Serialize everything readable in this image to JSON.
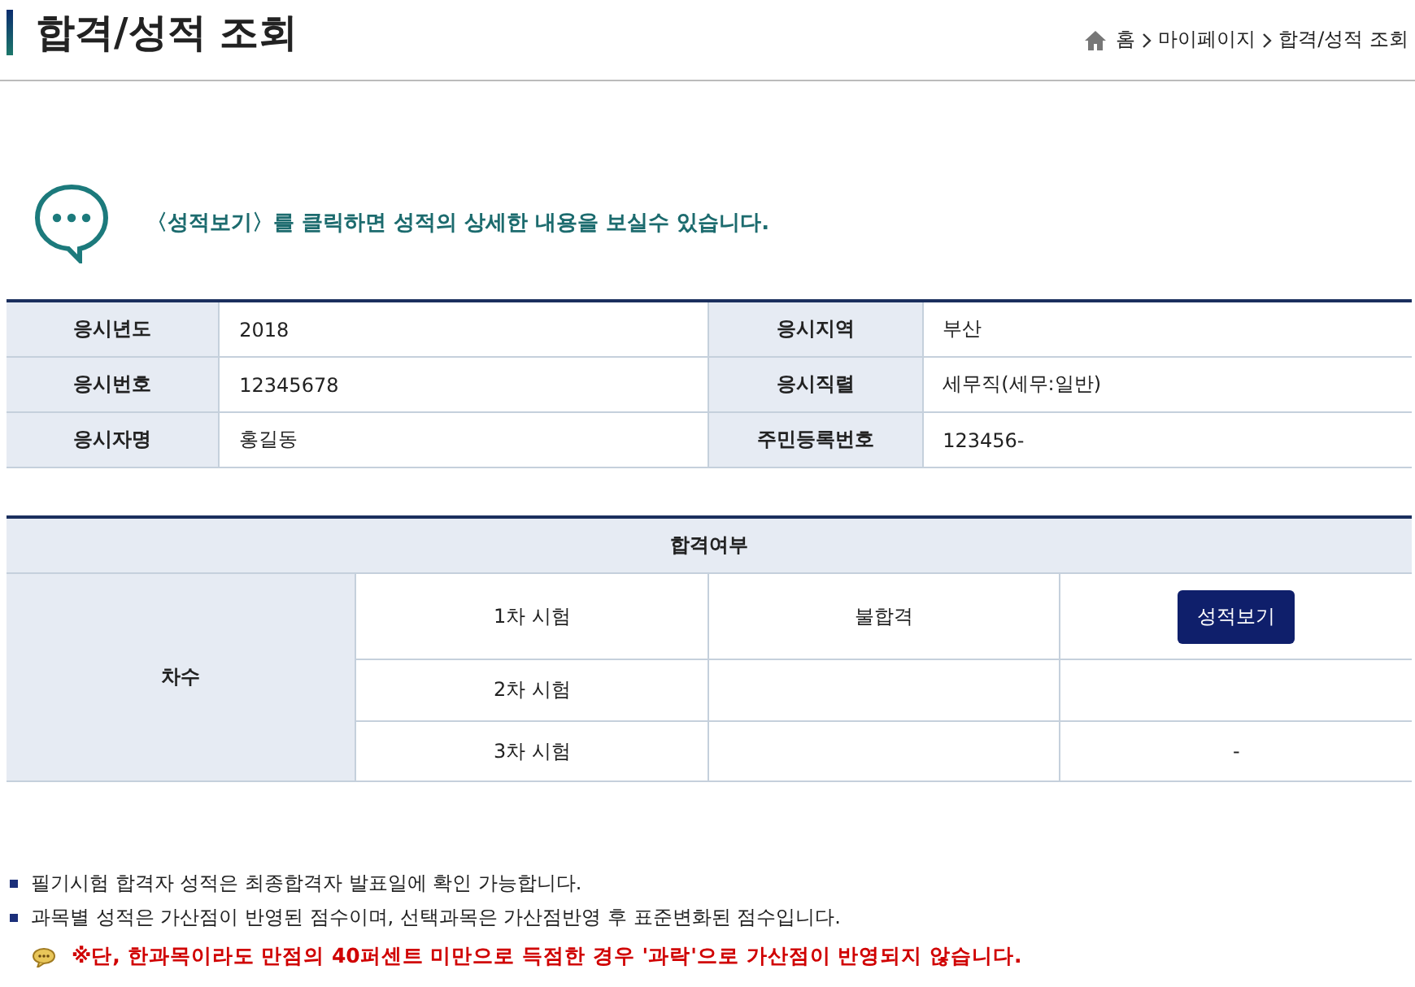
{
  "header": {
    "title": "합격/성적 조회",
    "breadcrumb": [
      "홈",
      "마이페이지",
      "합격/성적 조회"
    ]
  },
  "notice": "〈성적보기〉를 클릭하면 성적의 상세한 내용을 보실수 있습니다.",
  "applicant_info": [
    {
      "label": "응시년도",
      "value": "2018",
      "label_2": "응시지역",
      "value_2": "부산"
    },
    {
      "label": "응시번호",
      "value": "12345678",
      "label_2": "응시직렬",
      "value_2": "세무직(세무:일반)"
    },
    {
      "label": "응시자명",
      "value": "홍길동",
      "label_2": "주민등록번호",
      "value_2": "123456-"
    }
  ],
  "result_table": {
    "title": "합격여부",
    "row_header": "차수",
    "rows": [
      {
        "round": "1차 시험",
        "result": "불합격",
        "action": {
          "kind": "button",
          "label": "성적보기"
        }
      },
      {
        "round": "2차 시험"
      },
      {
        "round": "3차 시험",
        "action": {
          "kind": "text",
          "label": "-"
        }
      }
    ]
  },
  "notes": [
    "필기시험 합격자 성적은 최종합격자 발표일에 확인 가능합니다.",
    "과목별 성적은 가산점이 반영된 점수이며, 선택과목은 가산점반영 후 표준변화된 점수입니다."
  ],
  "warning": "※단, 한과목이라도 만점의 40퍼센트 미만으로 득점한 경우 '과락'으로 가산점이 반영되지 않습니다."
}
